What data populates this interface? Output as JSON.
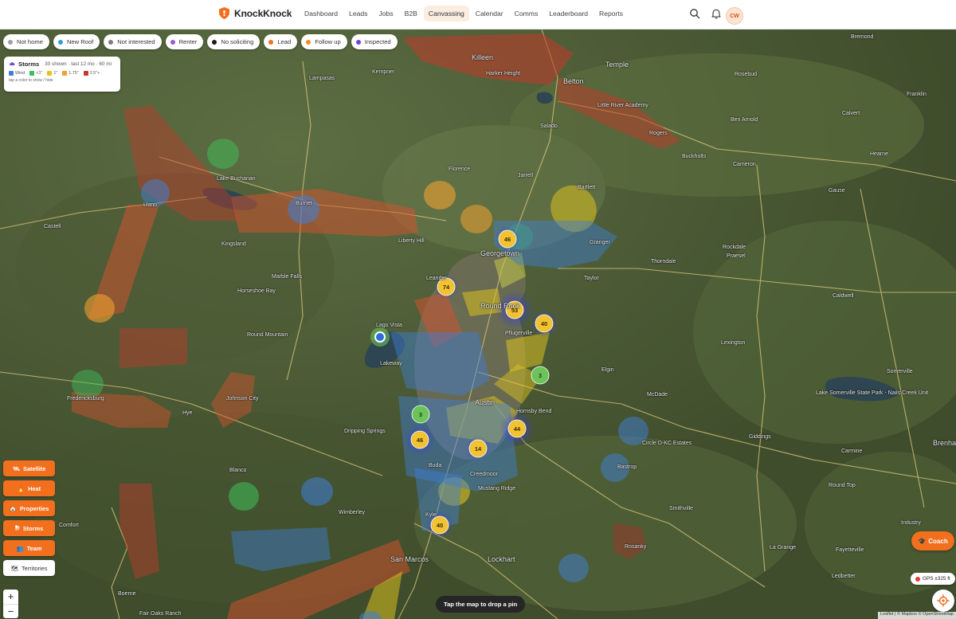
{
  "brand": {
    "name": "KnockKnock"
  },
  "nav": [
    "Dashboard",
    "Leads",
    "Jobs",
    "B2B",
    "Canvassing",
    "Calendar",
    "Comms",
    "Leaderboard",
    "Reports"
  ],
  "nav_active": "Canvassing",
  "user": {
    "initials": "CW"
  },
  "icons": {
    "search": "search-icon",
    "notifications": "bell-icon",
    "theme": "moon-icon"
  },
  "filters": [
    {
      "label": "Not home",
      "color": "#9e9e9e"
    },
    {
      "label": "New Roof",
      "color": "#2f9fd8"
    },
    {
      "label": "Not interested",
      "color": "#7d7d7d"
    },
    {
      "label": "Renter",
      "color": "#9b59d6"
    },
    {
      "label": "No soliciting",
      "color": "#1b1b1b"
    },
    {
      "label": "Lead",
      "color": "#f26f1e"
    },
    {
      "label": "Follow up",
      "color": "#f58a24"
    },
    {
      "label": "Inspected",
      "color": "#7b3fd4"
    }
  ],
  "storms": {
    "title": "Storms",
    "summary": "30 shown · last 12 mo · 60 mi",
    "hint": "tap a color to show / hide",
    "keys": [
      {
        "label": "Wind",
        "color": "#3f7fd8"
      },
      {
        "label": "<1\"",
        "color": "#3fbf5a"
      },
      {
        "label": "1\"",
        "color": "#e5c31a"
      },
      {
        "label": "1.75\"",
        "color": "#f0a030"
      },
      {
        "label": "2.5\"+",
        "color": "#c23a2a"
      }
    ]
  },
  "layers": [
    {
      "label": "Satellite",
      "icon": "satellite-icon"
    },
    {
      "label": "Heat",
      "icon": "flame-icon"
    },
    {
      "label": "Properties",
      "icon": "home-icon"
    },
    {
      "label": "Storms",
      "icon": "storm-icon"
    },
    {
      "label": "Team",
      "icon": "team-icon"
    },
    {
      "label": "Territories",
      "icon": "territories-icon"
    }
  ],
  "zoom": {
    "in": "+",
    "out": "−"
  },
  "tap_hint": "Tap the map to drop a pin",
  "coach": "Coach",
  "gps": "GPS ±325 ft",
  "attribution": "Leaflet | © Mapbox © OpenStreetMap",
  "clusters": [
    "46",
    "74",
    "53",
    "40",
    "3",
    "3",
    "46",
    "44",
    "14",
    "40"
  ],
  "places": [
    "Killeen",
    "Harker Height",
    "Belton",
    "Temple",
    "Little River Academy",
    "Rogers",
    "Salado",
    "Kempner",
    "Lampasas",
    "Rosebud",
    "Franklin",
    "Calvert",
    "Bremond",
    "Ben Arnold",
    "Buckholts",
    "Cameron",
    "Hearne",
    "Florence",
    "Jarrell",
    "Bartlett",
    "Lake Buchanan",
    "Burnet",
    "Llano",
    "Castell",
    "Kingsland",
    "Liberty Hill",
    "Georgetown",
    "Granger",
    "Thorndale",
    "Rockdale",
    "Praesel",
    "Gause",
    "Marble Falls",
    "Horseshoe Bay",
    "Leander",
    "Round Rock",
    "Taylor",
    "Caldwell",
    "Round Mountain",
    "Lago Vista",
    "Pflugerville",
    "Lexington",
    "Lakeway",
    "Austin",
    "Hornsby Bend",
    "Elgin",
    "McDade",
    "Somerville",
    "Lake Somerville State Park - Nails Creek Unit",
    "Fredericksburg",
    "Johnson City",
    "Hye",
    "Dripping Springs",
    "Buda",
    "Creedmoor",
    "Mustang Ridge",
    "Circle D-KC Estates",
    "Bastrop",
    "Giddings",
    "Blanco",
    "Wimberley",
    "Kyle",
    "Smithville",
    "Comfort",
    "San Marcos",
    "Lockhart",
    "Rosanky",
    "Industry",
    "Round Top",
    "La Grange",
    "Fayetteville",
    "Boerne",
    "Fair Oaks Ranch",
    "Ledbetter",
    "Carmine",
    "Brenham"
  ]
}
